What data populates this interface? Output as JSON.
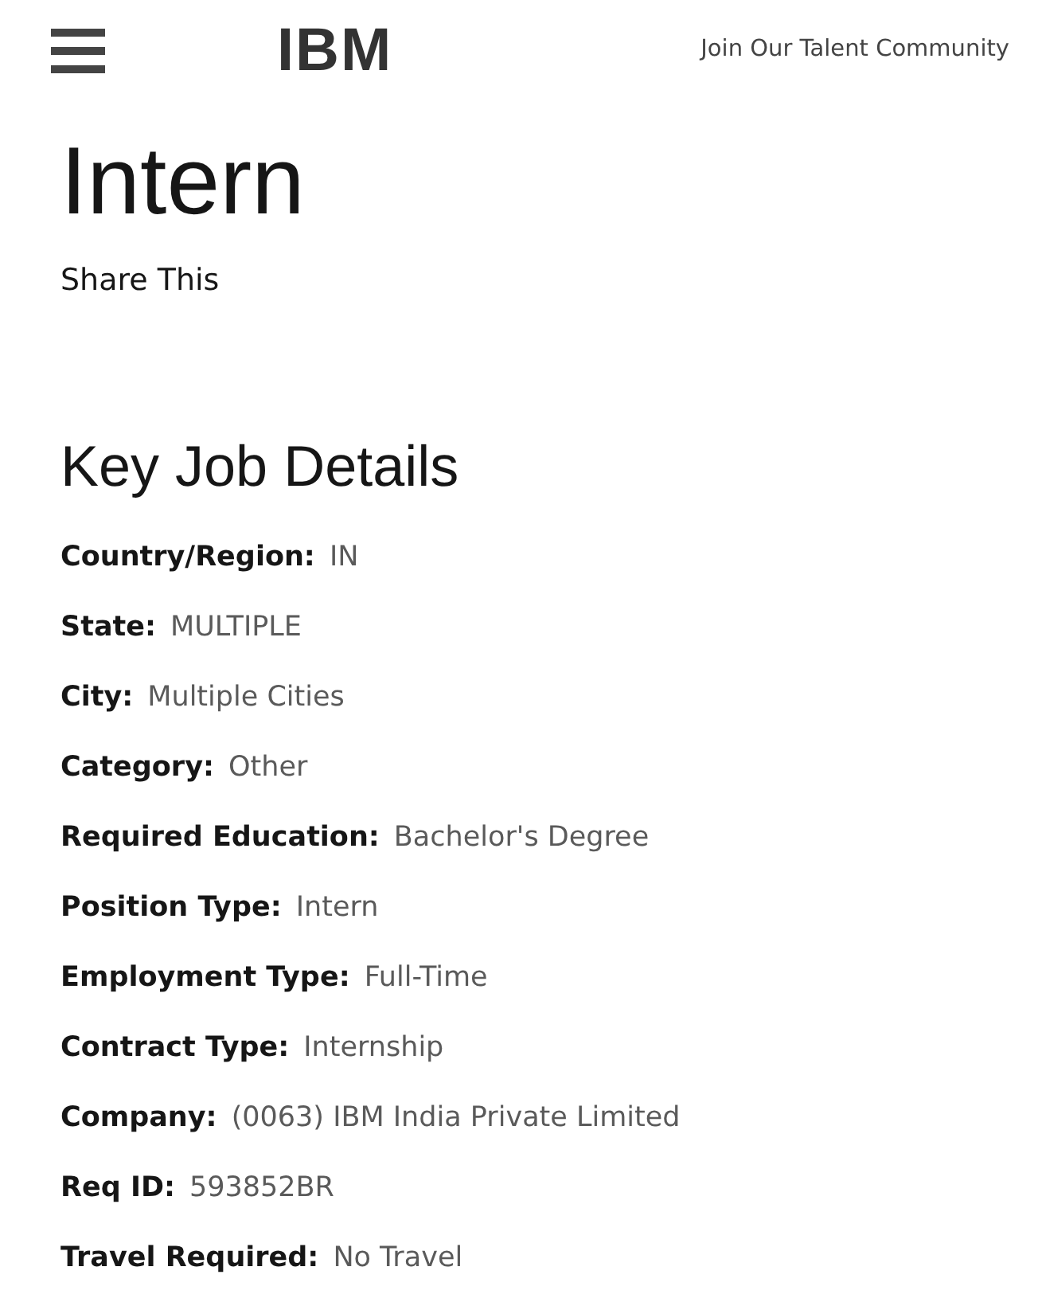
{
  "header": {
    "logo": "IBM",
    "link": "Join Our Talent Community"
  },
  "title": "Intern",
  "share": "Share This",
  "section_title": "Key Job Details",
  "details": [
    {
      "label": "Country/Region:",
      "value": "IN"
    },
    {
      "label": "State:",
      "value": "MULTIPLE"
    },
    {
      "label": "City:",
      "value": "Multiple Cities"
    },
    {
      "label": "Category:",
      "value": "Other"
    },
    {
      "label": "Required Education:",
      "value": "Bachelor's Degree"
    },
    {
      "label": "Position Type:",
      "value": "Intern"
    },
    {
      "label": "Employment Type:",
      "value": "Full-Time"
    },
    {
      "label": "Contract Type:",
      "value": "Internship"
    },
    {
      "label": "Company:",
      "value": "(0063) IBM India Private Limited"
    },
    {
      "label": "Req ID:",
      "value": "593852BR"
    },
    {
      "label": "Travel Required:",
      "value": "No Travel"
    }
  ]
}
